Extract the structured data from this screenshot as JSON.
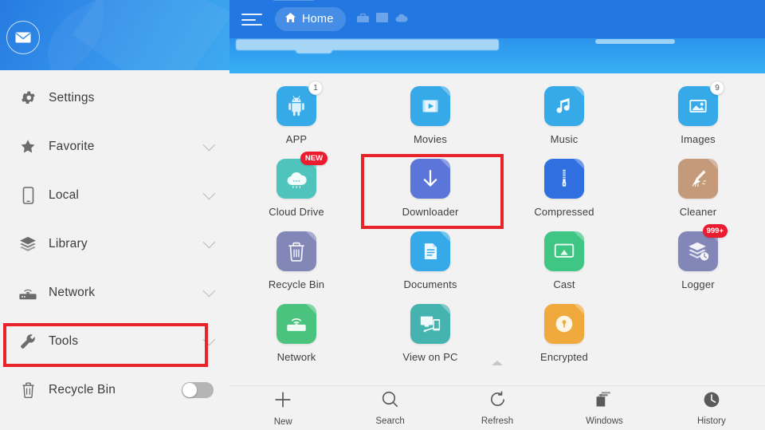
{
  "sidebar": {
    "avatar_icon": "envelope-icon",
    "items": [
      {
        "label": "Settings",
        "icon": "gear-icon",
        "chevron": false,
        "toggle": false,
        "highlight": false
      },
      {
        "label": "Favorite",
        "icon": "star-icon",
        "chevron": true,
        "toggle": false,
        "highlight": false
      },
      {
        "label": "Local",
        "icon": "phone-icon",
        "chevron": true,
        "toggle": false,
        "highlight": false
      },
      {
        "label": "Library",
        "icon": "layers-icon",
        "chevron": true,
        "toggle": false,
        "highlight": false
      },
      {
        "label": "Network",
        "icon": "router-icon",
        "chevron": true,
        "toggle": false,
        "highlight": false
      },
      {
        "label": "Tools",
        "icon": "wrench-icon",
        "chevron": true,
        "toggle": false,
        "highlight": true
      },
      {
        "label": "Recycle Bin",
        "icon": "trash-icon",
        "chevron": false,
        "toggle": true,
        "highlight": false
      }
    ],
    "toggle_state": "off"
  },
  "topbar": {
    "menu_icon": "hamburger-menu-icon",
    "home_label": "Home",
    "home_icon": "house-icon",
    "tab_icons": [
      "toolbox-icon",
      "window-icon",
      "cloud-icon"
    ]
  },
  "grid": {
    "rows": [
      [
        {
          "label": "APP",
          "icon": "android-icon",
          "color": "#36a9e8",
          "badge": "1",
          "badge_style": "light"
        },
        {
          "label": "Movies",
          "icon": "video-file-icon",
          "color": "#36a9e8",
          "badge": "",
          "badge_style": ""
        },
        {
          "label": "Music",
          "icon": "music-file-icon",
          "color": "#36a9e8",
          "badge": "",
          "badge_style": ""
        },
        {
          "label": "Images",
          "icon": "image-file-icon",
          "color": "#36a9e8",
          "badge": "9",
          "badge_style": "light"
        }
      ],
      [
        {
          "label": "Cloud Drive",
          "icon": "cloud-icon",
          "color": "#4fc4bd",
          "badge": "NEW",
          "badge_style": "new"
        },
        {
          "label": "Downloader",
          "icon": "download-arrow-icon",
          "color": "#5b76d8",
          "badge": "",
          "badge_style": "",
          "selected": true
        },
        {
          "label": "Compressed",
          "icon": "zip-icon",
          "color": "#2f6fe0",
          "badge": "",
          "badge_style": ""
        },
        {
          "label": "Cleaner",
          "icon": "broom-icon",
          "color": "#c49a7a",
          "badge": "",
          "badge_style": ""
        }
      ],
      [
        {
          "label": "Recycle Bin",
          "icon": "trash-icon",
          "color": "#8287b8",
          "badge": "",
          "badge_style": ""
        },
        {
          "label": "Documents",
          "icon": "document-file-icon",
          "color": "#36a9e8",
          "badge": "",
          "badge_style": ""
        },
        {
          "label": "Cast",
          "icon": "cast-icon",
          "color": "#3fc584",
          "badge": "",
          "badge_style": ""
        },
        {
          "label": "Logger",
          "icon": "logger-icon",
          "color": "#8287b8",
          "badge": "999+",
          "badge_style": "red"
        }
      ],
      [
        {
          "label": "Network",
          "icon": "router-icon",
          "color": "#49c37e",
          "badge": "",
          "badge_style": ""
        },
        {
          "label": "View on PC",
          "icon": "view-on-pc-icon",
          "color": "#45b3b0",
          "badge": "",
          "badge_style": ""
        },
        {
          "label": "Encrypted",
          "icon": "lock-icon",
          "color": "#f0a93c",
          "badge": "",
          "badge_style": ""
        }
      ]
    ]
  },
  "bottombar": {
    "items": [
      {
        "label": "New",
        "icon": "plus-icon"
      },
      {
        "label": "Search",
        "icon": "search-icon"
      },
      {
        "label": "Refresh",
        "icon": "refresh-icon"
      },
      {
        "label": "Windows",
        "icon": "windows-stack-icon"
      },
      {
        "label": "History",
        "icon": "history-clock-icon"
      }
    ]
  },
  "colors": {
    "accent_blue": "#2278e0",
    "highlight_red": "#e8242a",
    "badge_red": "#ec1c30"
  }
}
